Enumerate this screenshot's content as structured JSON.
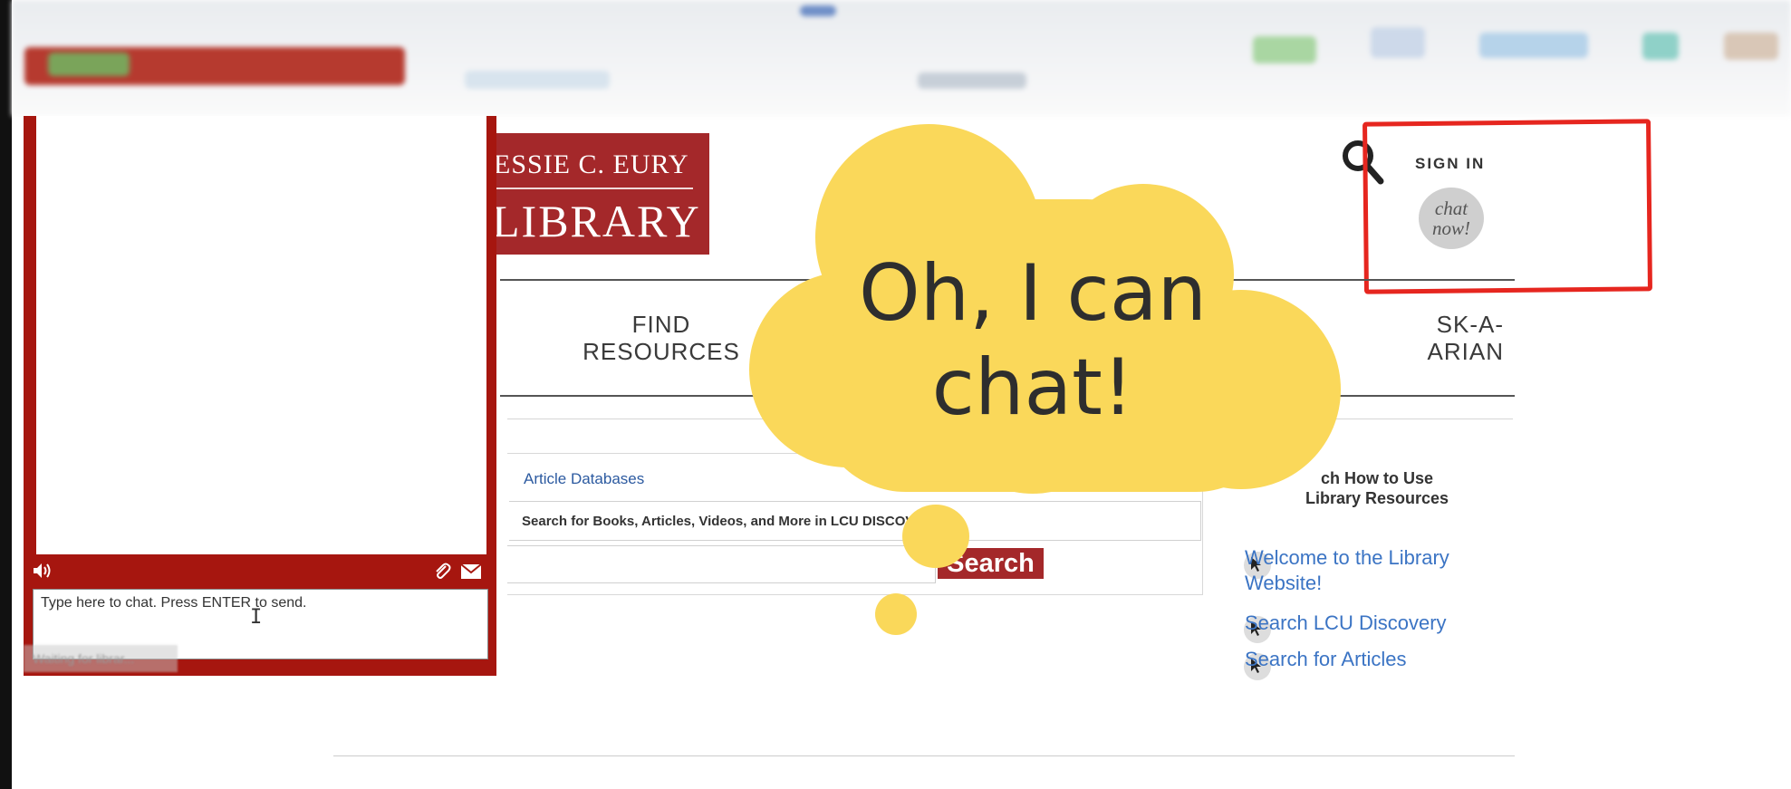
{
  "colors": {
    "brand_red": "#a4282a",
    "chat_red": "#a6160f",
    "highlight": "#e6261f",
    "bubble": "#fad85a",
    "link": "#3b74c4"
  },
  "library": {
    "logo_top": "ESSIE C. EURY",
    "logo_bottom": "LIBRARY"
  },
  "header": {
    "sign_in": "SIGN IN",
    "chat_now_line1": "chat",
    "chat_now_line2": "now!",
    "search_icon": "search-icon"
  },
  "nav": {
    "find_line1": "FIND",
    "find_line2": "RESOURCES",
    "ask_line1": "SK-A-",
    "ask_line2": "ARIAN"
  },
  "search": {
    "tab": "Article Databases",
    "label": "Search for Books, Articles, Videos, and More in LCU DISCOVERY",
    "button": "Search"
  },
  "sidebar": {
    "heading_line1": "ch How to Use",
    "heading_line2": "Library Resources",
    "links": [
      "Welcome to the Library",
      "Website!",
      "Search LCU Discovery",
      "Search for Articles"
    ]
  },
  "chat": {
    "placeholder": "Type here to chat. Press ENTER to send.",
    "status": "Waiting for librar...",
    "icons": [
      "speaker-icon",
      "paperclip-icon",
      "envelope-icon"
    ]
  },
  "bubble": {
    "line1": "Oh, I can",
    "line2": "chat!"
  }
}
